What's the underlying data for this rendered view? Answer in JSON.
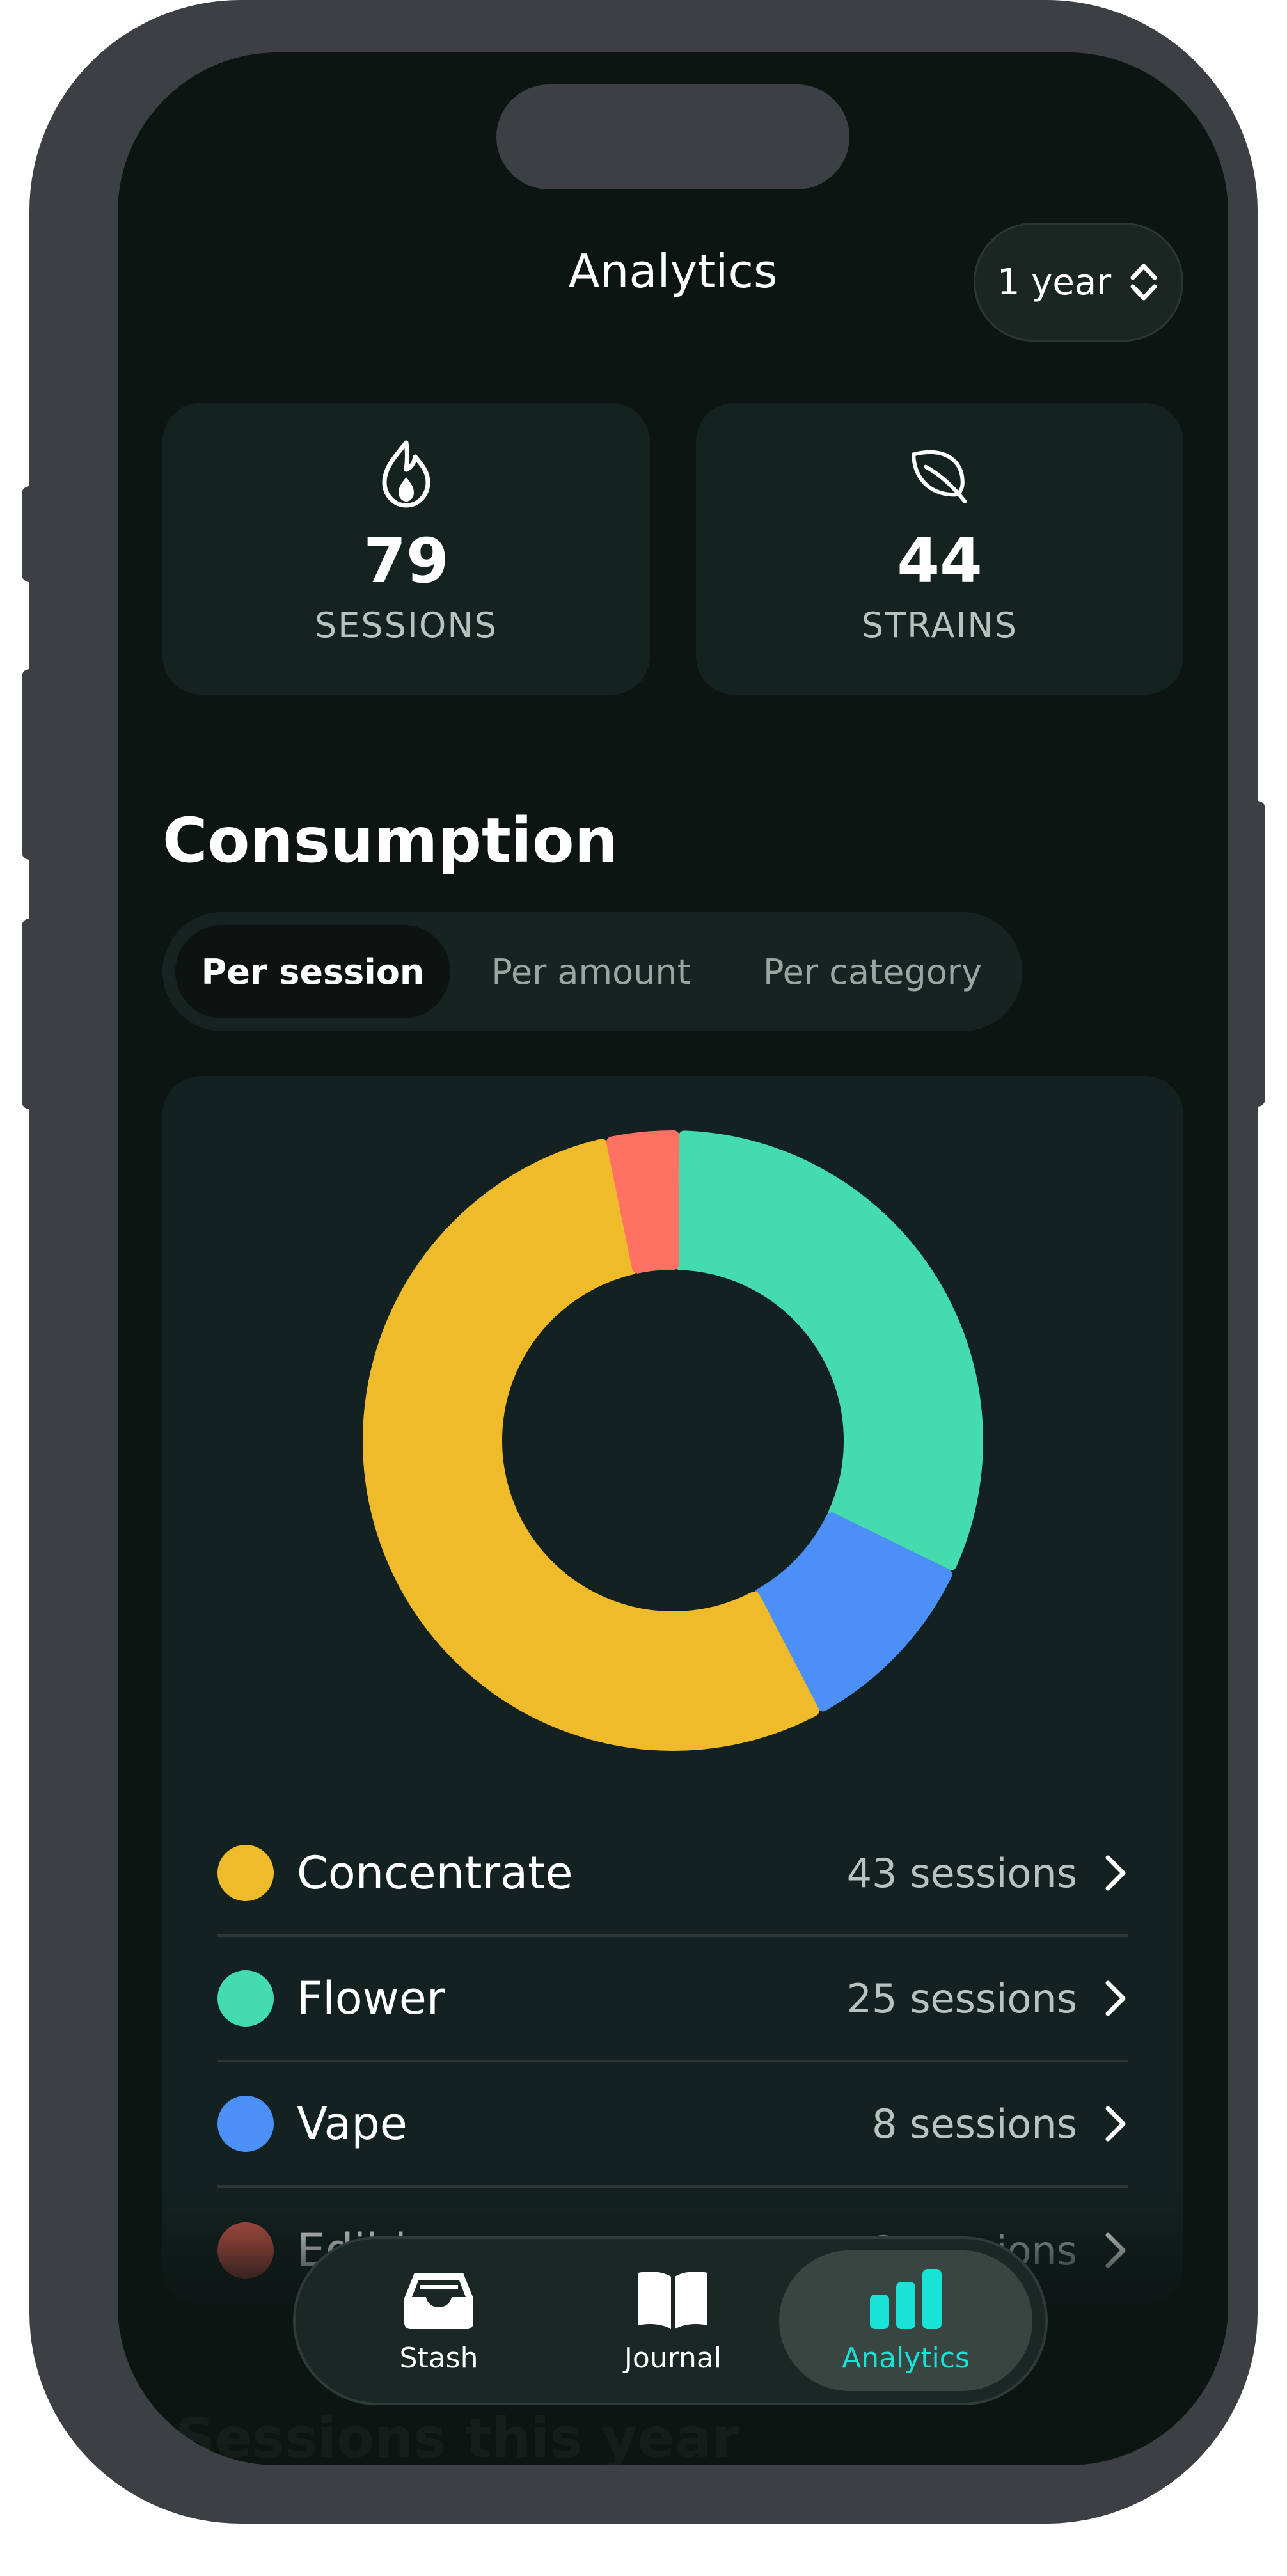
{
  "header": {
    "title": "Analytics",
    "range_label": "1 year"
  },
  "stats": [
    {
      "value": "79",
      "label": "SESSIONS",
      "icon": "flame-icon"
    },
    {
      "value": "44",
      "label": "STRAINS",
      "icon": "leaf-icon"
    }
  ],
  "consumption": {
    "title": "Consumption",
    "segments": [
      "Per session",
      "Per amount",
      "Per category"
    ],
    "selected_segment": "Per session"
  },
  "chart_data": {
    "type": "pie",
    "variant": "donut",
    "categories": [
      "Concentrate",
      "Flower",
      "Vape",
      "Edible"
    ],
    "values": [
      43,
      25,
      8,
      3
    ],
    "colors": [
      "#f0bb2b",
      "#44dbad",
      "#4b8ff7",
      "#ff7163"
    ]
  },
  "legend": [
    {
      "name": "Concentrate",
      "count": "43 sessions",
      "color": "#f0bb2b"
    },
    {
      "name": "Flower",
      "count": "25 sessions",
      "color": "#44dbad"
    },
    {
      "name": "Vape",
      "count": "8 sessions",
      "color": "#4b8ff7"
    },
    {
      "name": "Edible",
      "count": "3 sessions",
      "color": "#d65a4e"
    }
  ],
  "next_section_title": "Sessions this year",
  "tabbar": [
    {
      "label": "Stash",
      "icon": "tray-icon"
    },
    {
      "label": "Journal",
      "icon": "book-icon"
    },
    {
      "label": "Analytics",
      "icon": "bar-chart-icon",
      "active": true
    }
  ],
  "colors": {
    "accent": "#19e3d6",
    "background": "#0d1513",
    "card": "#132220"
  }
}
